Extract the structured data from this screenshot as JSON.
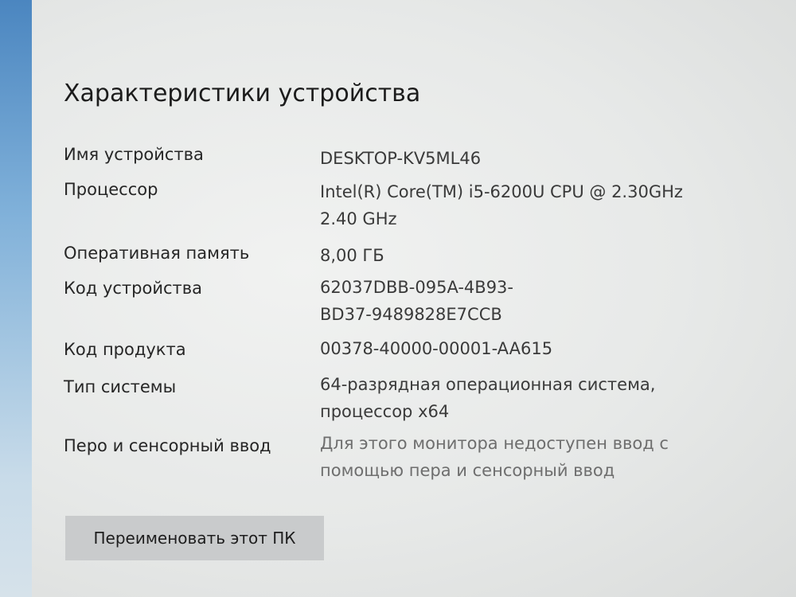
{
  "section": {
    "title": "Характеристики устройства"
  },
  "specs": {
    "device_name": {
      "label": "Имя устройства",
      "value": "DESKTOP-KV5ML46"
    },
    "processor": {
      "label": "Процессор",
      "value_line1": "Intel(R) Core(TM) i5-6200U CPU @ 2.30GHz",
      "value_line2": "2.40 GHz"
    },
    "ram": {
      "label": "Оперативная память",
      "value": "8,00 ГБ"
    },
    "device_id": {
      "label": "Код устройства",
      "value_line1": "62037DBB-095A-4B93-",
      "value_line2": "BD37-9489828E7CCB"
    },
    "product_id": {
      "label": "Код продукта",
      "value": "00378-40000-00001-AA615"
    },
    "system_type": {
      "label": "Тип системы",
      "value_line1": "64-разрядная операционная система,",
      "value_line2": "процессор x64"
    },
    "pen_touch": {
      "label": "Перо и сенсорный ввод",
      "value_line1": "Для этого монитора недоступен ввод с",
      "value_line2": "помощью пера и сенсорный ввод"
    }
  },
  "actions": {
    "rename_label": "Переименовать этот ПК"
  }
}
